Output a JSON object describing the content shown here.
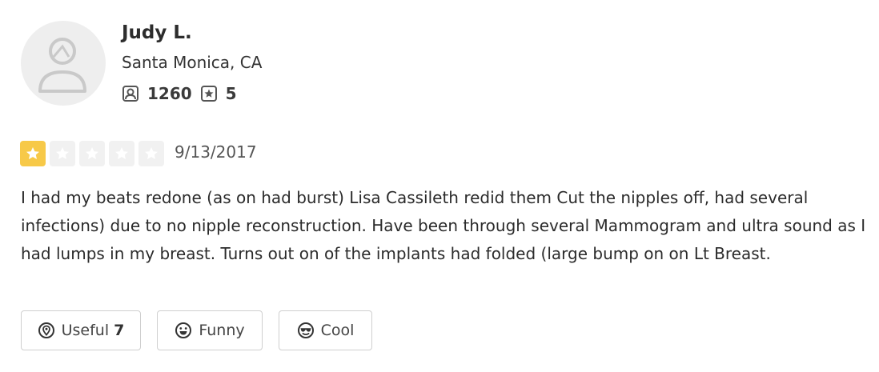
{
  "user": {
    "name": "Judy L.",
    "location": "Santa Monica, CA",
    "friends_count": "1260",
    "reviews_count": "5"
  },
  "review": {
    "rating": 1,
    "max_rating": 5,
    "date": "9/13/2017",
    "text": "I had my beats redone (as on had burst) Lisa Cassileth redid them Cut the nipples off, had several infections) due to no nipple reconstruction. Have been through several Mammogram and ultra sound as I had lumps in my breast. Turns out on of the implants had folded (large bump on on  Lt Breast."
  },
  "actions": {
    "useful_label": "Useful",
    "useful_count": "7",
    "funny_label": "Funny",
    "cool_label": "Cool"
  },
  "colors": {
    "star_on": "#f7c948",
    "star_off": "#f1f1f1"
  }
}
